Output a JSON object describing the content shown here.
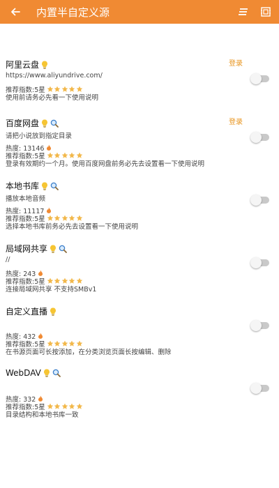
{
  "header": {
    "title": "内置半自定义源",
    "back_icon": "arrow-left-icon",
    "actions": [
      "sort-icon",
      "scan-icon"
    ],
    "bg_color": "#f08a33"
  },
  "sources": [
    {
      "name": "阿里云盘",
      "has_search": false,
      "login_label": "登录",
      "subtitle": "https://www.aliyundrive.com/",
      "heat": "",
      "rating_label": "推荐指数:5星",
      "stars": 5,
      "note": "使用前请务必先看一下使用说明",
      "enabled": false
    },
    {
      "name": "百度网盘",
      "has_search": true,
      "login_label": "登录",
      "subtitle": "请把小说放到指定目录",
      "heat": "热度: 13146",
      "rating_label": "推荐指数:5星",
      "stars": 5,
      "note": "登录有效期约一个月。使用百度网盘前务必先去设置看一下使用说明",
      "enabled": false
    },
    {
      "name": "本地书库",
      "has_search": true,
      "login_label": "",
      "subtitle": "播放本地音频",
      "heat": "热度: 11117",
      "rating_label": "推荐指数:5星",
      "stars": 5,
      "note": "选择本地书库前务必先去设置看一下使用说明",
      "enabled": false
    },
    {
      "name": "局域网共享",
      "has_search": true,
      "login_label": "",
      "subtitle": "//",
      "heat": "热度: 243",
      "rating_label": "推荐指数:5星",
      "stars": 5,
      "note": "连接局域网共享 不支持SMBv1",
      "enabled": false
    },
    {
      "name": "自定义直播",
      "has_search": false,
      "login_label": "",
      "subtitle": "",
      "heat": "热度: 432",
      "rating_label": "推荐指数:5星",
      "stars": 5,
      "note": "在书源页面可长按添加，在分类浏览页面长按编辑、删除",
      "enabled": false
    },
    {
      "name": "WebDAV",
      "has_search": true,
      "login_label": "",
      "subtitle": "",
      "heat": "热度: 332",
      "rating_label": "推荐指数:5星",
      "stars": 5,
      "note": "目录结构和本地书库一致",
      "enabled": false
    }
  ],
  "colors": {
    "accent": "#e8951f",
    "star": "#f2b84b",
    "bulb": "#f6c533",
    "flame": "#f08a33",
    "toggle_off": "#c9c9c9"
  }
}
